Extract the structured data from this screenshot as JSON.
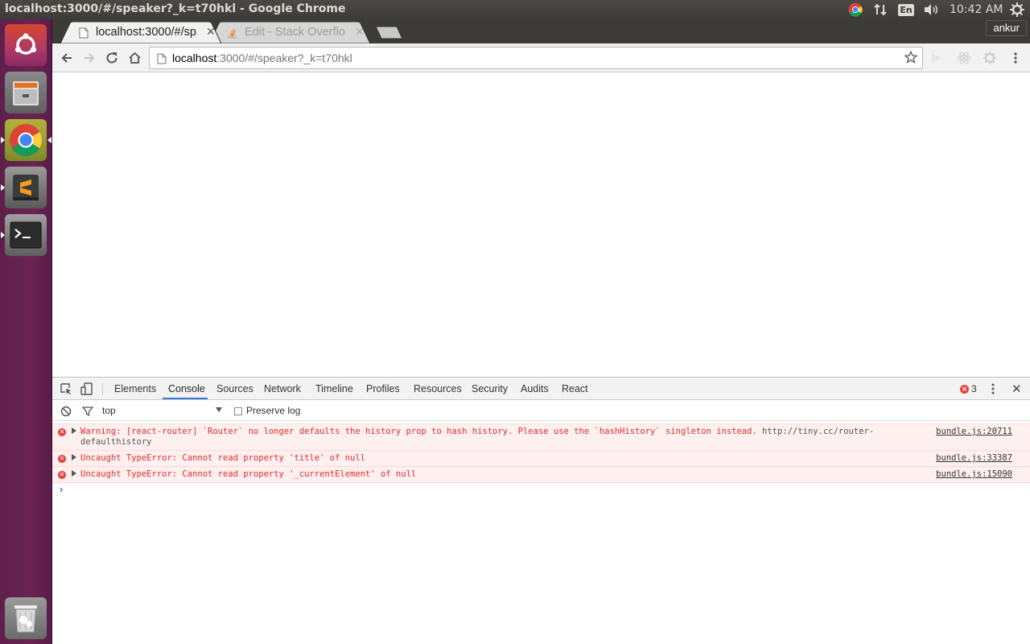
{
  "top_panel": {
    "window_title": "localhost:3000/#/speaker?_k=t70hkl - Google Chrome",
    "language": "En",
    "clock": "10:42 AM"
  },
  "launcher": {
    "items": [
      "ubuntu-dash",
      "files",
      "google-chrome",
      "sublime-text",
      "terminal",
      "trash"
    ]
  },
  "browser": {
    "profile_name": "ankur",
    "tabs": [
      {
        "title": "localhost:3000/#/sp",
        "active": true
      },
      {
        "title": "Edit - Stack Overflo",
        "active": false
      }
    ],
    "url_host": "localhost",
    "url_rest": ":3000/#/speaker?_k=t70hkl"
  },
  "devtools": {
    "tabs": [
      "Elements",
      "Console",
      "Sources",
      "Network",
      "Timeline",
      "Profiles",
      "Resources",
      "Security",
      "Audits",
      "React"
    ],
    "active_tab": "Console",
    "error_count": "3",
    "context": "top",
    "preserve_log_label": "Preserve log",
    "preserve_log_checked": false,
    "messages": [
      {
        "text": "Warning: [react-router] `Router` no longer defaults the history prop to hash history. Please use the `hashHistory` singleton instead.",
        "link": "http://tiny.cc/router-defaulthistory",
        "source": "bundle.js:20711"
      },
      {
        "text": "Uncaught TypeError: Cannot read property 'title' of null",
        "link": "",
        "source": "bundle.js:33387"
      },
      {
        "text": "Uncaught TypeError: Cannot read property '_currentElement' of null",
        "link": "",
        "source": "bundle.js:15090"
      }
    ],
    "prompt_symbol": "›"
  },
  "colors": {
    "launcher_bg": "#6a2452",
    "panel_bg": "#3c3b37",
    "error_red": "#e02a2a",
    "devtools_accent": "#3879d9"
  }
}
